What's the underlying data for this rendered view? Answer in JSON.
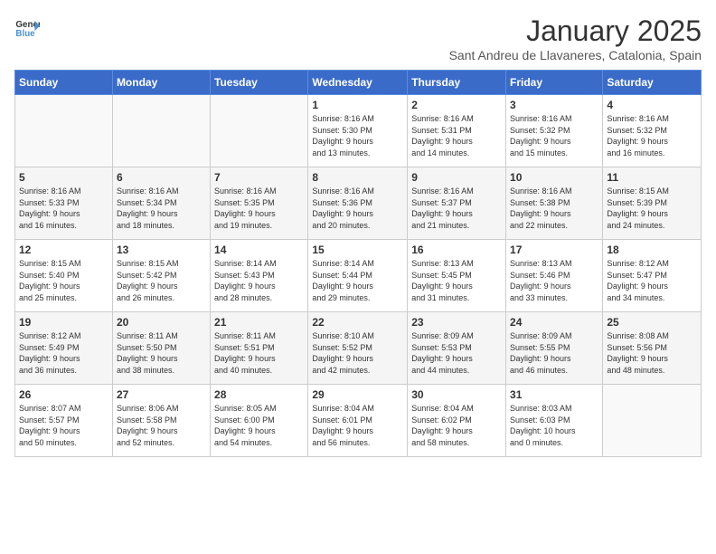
{
  "header": {
    "logo_line1": "General",
    "logo_line2": "Blue",
    "title": "January 2025",
    "subtitle": "Sant Andreu de Llavaneres, Catalonia, Spain"
  },
  "weekdays": [
    "Sunday",
    "Monday",
    "Tuesday",
    "Wednesday",
    "Thursday",
    "Friday",
    "Saturday"
  ],
  "weeks": [
    [
      {
        "day": "",
        "detail": ""
      },
      {
        "day": "",
        "detail": ""
      },
      {
        "day": "",
        "detail": ""
      },
      {
        "day": "1",
        "detail": "Sunrise: 8:16 AM\nSunset: 5:30 PM\nDaylight: 9 hours\nand 13 minutes."
      },
      {
        "day": "2",
        "detail": "Sunrise: 8:16 AM\nSunset: 5:31 PM\nDaylight: 9 hours\nand 14 minutes."
      },
      {
        "day": "3",
        "detail": "Sunrise: 8:16 AM\nSunset: 5:32 PM\nDaylight: 9 hours\nand 15 minutes."
      },
      {
        "day": "4",
        "detail": "Sunrise: 8:16 AM\nSunset: 5:32 PM\nDaylight: 9 hours\nand 16 minutes."
      }
    ],
    [
      {
        "day": "5",
        "detail": "Sunrise: 8:16 AM\nSunset: 5:33 PM\nDaylight: 9 hours\nand 16 minutes."
      },
      {
        "day": "6",
        "detail": "Sunrise: 8:16 AM\nSunset: 5:34 PM\nDaylight: 9 hours\nand 18 minutes."
      },
      {
        "day": "7",
        "detail": "Sunrise: 8:16 AM\nSunset: 5:35 PM\nDaylight: 9 hours\nand 19 minutes."
      },
      {
        "day": "8",
        "detail": "Sunrise: 8:16 AM\nSunset: 5:36 PM\nDaylight: 9 hours\nand 20 minutes."
      },
      {
        "day": "9",
        "detail": "Sunrise: 8:16 AM\nSunset: 5:37 PM\nDaylight: 9 hours\nand 21 minutes."
      },
      {
        "day": "10",
        "detail": "Sunrise: 8:16 AM\nSunset: 5:38 PM\nDaylight: 9 hours\nand 22 minutes."
      },
      {
        "day": "11",
        "detail": "Sunrise: 8:15 AM\nSunset: 5:39 PM\nDaylight: 9 hours\nand 24 minutes."
      }
    ],
    [
      {
        "day": "12",
        "detail": "Sunrise: 8:15 AM\nSunset: 5:40 PM\nDaylight: 9 hours\nand 25 minutes."
      },
      {
        "day": "13",
        "detail": "Sunrise: 8:15 AM\nSunset: 5:42 PM\nDaylight: 9 hours\nand 26 minutes."
      },
      {
        "day": "14",
        "detail": "Sunrise: 8:14 AM\nSunset: 5:43 PM\nDaylight: 9 hours\nand 28 minutes."
      },
      {
        "day": "15",
        "detail": "Sunrise: 8:14 AM\nSunset: 5:44 PM\nDaylight: 9 hours\nand 29 minutes."
      },
      {
        "day": "16",
        "detail": "Sunrise: 8:13 AM\nSunset: 5:45 PM\nDaylight: 9 hours\nand 31 minutes."
      },
      {
        "day": "17",
        "detail": "Sunrise: 8:13 AM\nSunset: 5:46 PM\nDaylight: 9 hours\nand 33 minutes."
      },
      {
        "day": "18",
        "detail": "Sunrise: 8:12 AM\nSunset: 5:47 PM\nDaylight: 9 hours\nand 34 minutes."
      }
    ],
    [
      {
        "day": "19",
        "detail": "Sunrise: 8:12 AM\nSunset: 5:49 PM\nDaylight: 9 hours\nand 36 minutes."
      },
      {
        "day": "20",
        "detail": "Sunrise: 8:11 AM\nSunset: 5:50 PM\nDaylight: 9 hours\nand 38 minutes."
      },
      {
        "day": "21",
        "detail": "Sunrise: 8:11 AM\nSunset: 5:51 PM\nDaylight: 9 hours\nand 40 minutes."
      },
      {
        "day": "22",
        "detail": "Sunrise: 8:10 AM\nSunset: 5:52 PM\nDaylight: 9 hours\nand 42 minutes."
      },
      {
        "day": "23",
        "detail": "Sunrise: 8:09 AM\nSunset: 5:53 PM\nDaylight: 9 hours\nand 44 minutes."
      },
      {
        "day": "24",
        "detail": "Sunrise: 8:09 AM\nSunset: 5:55 PM\nDaylight: 9 hours\nand 46 minutes."
      },
      {
        "day": "25",
        "detail": "Sunrise: 8:08 AM\nSunset: 5:56 PM\nDaylight: 9 hours\nand 48 minutes."
      }
    ],
    [
      {
        "day": "26",
        "detail": "Sunrise: 8:07 AM\nSunset: 5:57 PM\nDaylight: 9 hours\nand 50 minutes."
      },
      {
        "day": "27",
        "detail": "Sunrise: 8:06 AM\nSunset: 5:58 PM\nDaylight: 9 hours\nand 52 minutes."
      },
      {
        "day": "28",
        "detail": "Sunrise: 8:05 AM\nSunset: 6:00 PM\nDaylight: 9 hours\nand 54 minutes."
      },
      {
        "day": "29",
        "detail": "Sunrise: 8:04 AM\nSunset: 6:01 PM\nDaylight: 9 hours\nand 56 minutes."
      },
      {
        "day": "30",
        "detail": "Sunrise: 8:04 AM\nSunset: 6:02 PM\nDaylight: 9 hours\nand 58 minutes."
      },
      {
        "day": "31",
        "detail": "Sunrise: 8:03 AM\nSunset: 6:03 PM\nDaylight: 10 hours\nand 0 minutes."
      },
      {
        "day": "",
        "detail": ""
      }
    ]
  ]
}
